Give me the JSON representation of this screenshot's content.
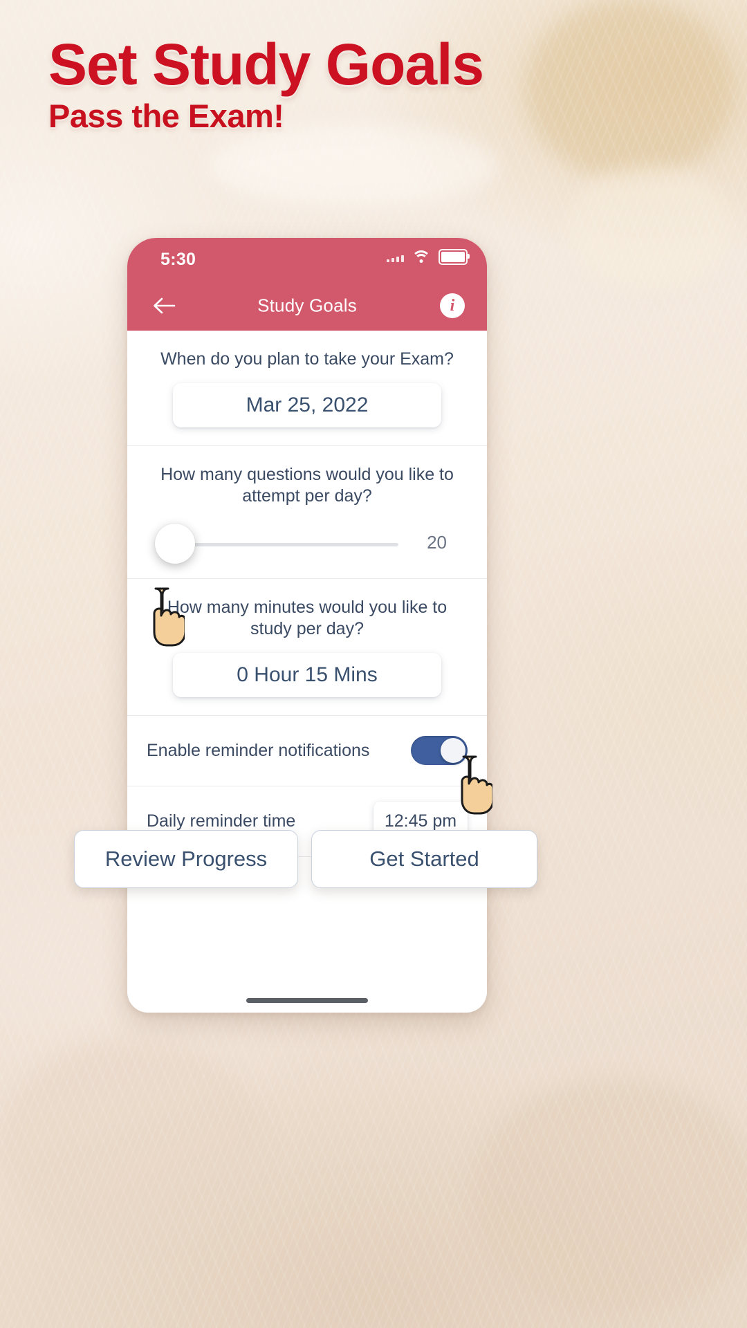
{
  "banner": {
    "title": "Set Study Goals",
    "subtitle": "Pass the Exam!",
    "title_color": "#cc1122",
    "background_color": "#f3e7da"
  },
  "phone": {
    "status_bar": {
      "time": "5:30",
      "signal_icon": "signal-bars-icon",
      "wifi_icon": "wifi-icon",
      "battery_icon": "battery-full-icon"
    },
    "nav_bar": {
      "back_icon": "back-arrow-icon",
      "title": "Study Goals",
      "info_icon": "info-icon",
      "background_color": "#d2596c"
    },
    "form": {
      "exam_date": {
        "question": "When do you plan to take your Exam?",
        "value": "Mar 25, 2022"
      },
      "questions_per_day": {
        "question": "How many questions would you like to attempt per day?",
        "value": "20",
        "slider_position_percent": 0
      },
      "minutes_per_day": {
        "question": "How many minutes would you like to study per day?",
        "value": "0 Hour 15 Mins"
      },
      "reminder_toggle": {
        "label": "Enable reminder notifications",
        "state": "on",
        "accent_color": "#3f5f9e"
      },
      "reminder_time": {
        "label": "Daily reminder time",
        "value": "12:45 pm"
      }
    },
    "actions": {
      "review_label": "Review Progress",
      "start_label": "Get Started"
    },
    "home_indicator": "home-indicator"
  }
}
